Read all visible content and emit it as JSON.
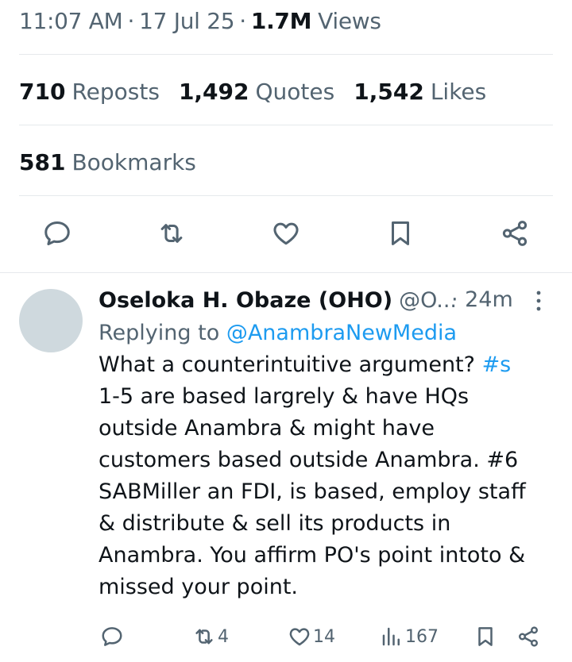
{
  "tweet_meta": {
    "time": "11:07 AM",
    "date": "17 Jul 25",
    "views_count": "1.7M",
    "views_label": "Views"
  },
  "stats": {
    "reposts_count": "710",
    "reposts_label": "Reposts",
    "quotes_count": "1,492",
    "quotes_label": "Quotes",
    "likes_count": "1,542",
    "likes_label": "Likes",
    "bookmarks_count": "581",
    "bookmarks_label": "Bookmarks"
  },
  "actions": {
    "icons": [
      "reply-icon",
      "repost-icon",
      "like-icon",
      "bookmark-icon",
      "share-icon"
    ]
  },
  "reply": {
    "author_name": "Oseloka H. Obaze (OHO)",
    "author_handle": "@O...",
    "time": "· 24m",
    "replying_prefix": "Replying to",
    "replying_handle": "@AnambraNewMedia",
    "text_lines": [
      "What a counterintuitive argument? ",
      "1-5 are based largrely & have HQs",
      "outside Anambra & might have",
      "customers based outside Anambra. #6",
      "SABMiller an FDI, is based, employ staff",
      "& distribute & sell  its products in",
      "Anambra. You affirm PO's point intoto &",
      "missed your point."
    ],
    "hashtag": "#s",
    "actions": {
      "reposts": "4",
      "likes": "14",
      "views": "167"
    }
  },
  "colors": {
    "accent": "#1d9bf0",
    "secondary_text": "#536471",
    "primary_text": "#0f1419",
    "divider": "#e6e9ec",
    "avatar_placeholder": "#cfd9de"
  }
}
